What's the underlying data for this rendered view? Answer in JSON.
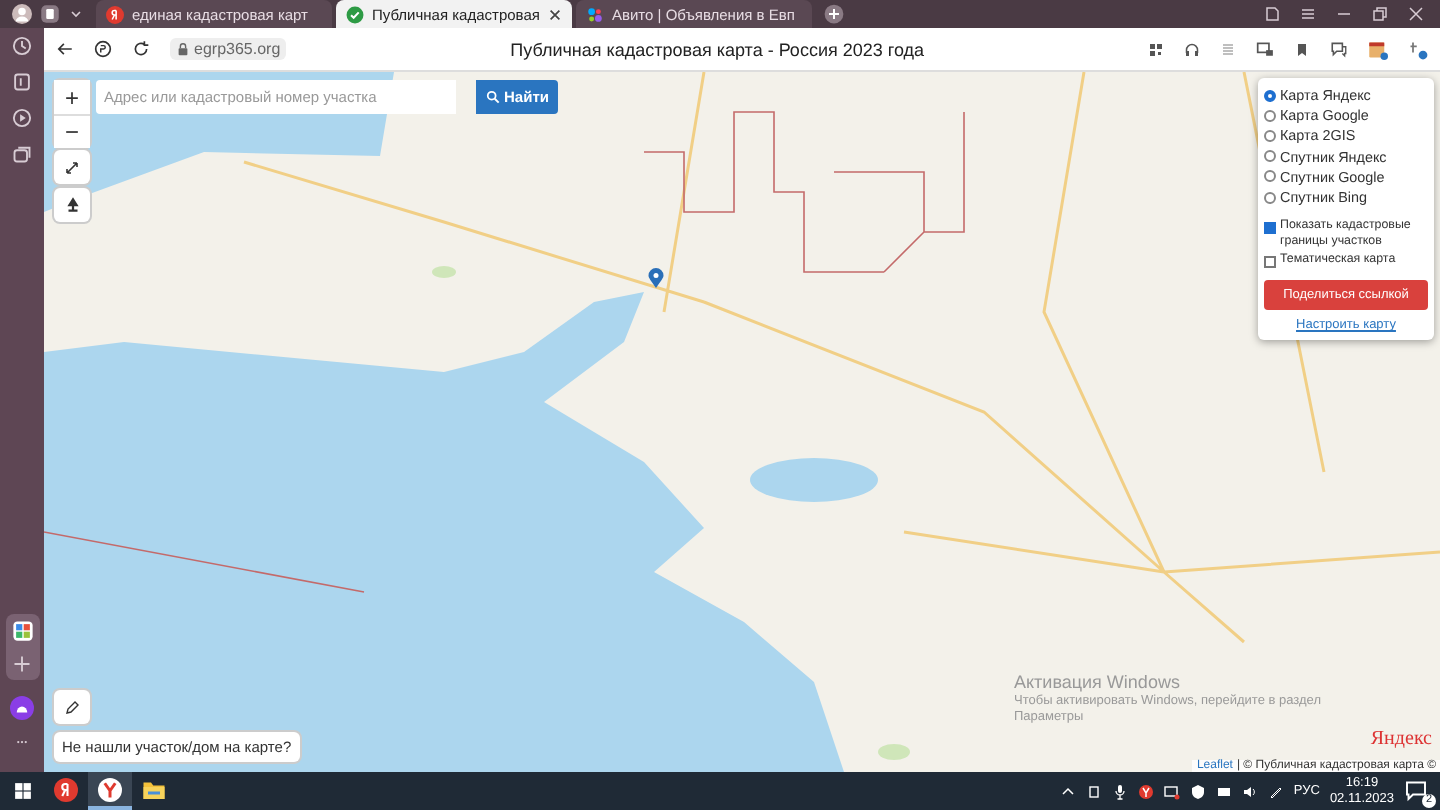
{
  "browser": {
    "tabs": [
      {
        "title": "единая кадастровая карт",
        "kind": "yandex",
        "selected": false
      },
      {
        "title": "Публичная кадастровая",
        "kind": "shield",
        "selected": true
      },
      {
        "title": "Авито | Объявления в Евп",
        "kind": "avito",
        "selected": false
      }
    ],
    "domain": "egrp365.org",
    "page_title": "Публичная кадастровая карта - Россия 2023 года"
  },
  "map": {
    "zoom_in": "+",
    "zoom_out": "−",
    "search": {
      "placeholder": "Адрес или кадастровый номер участка",
      "button": "Найти"
    },
    "layers": [
      {
        "label": "Карта Яндекс",
        "selected": true
      },
      {
        "label": "Карта Google",
        "selected": false
      },
      {
        "label": "Карта 2GIS",
        "selected": false
      },
      {
        "label": "Спутник Яндекс",
        "selected": false
      },
      {
        "label": "Спутник Google",
        "selected": false
      },
      {
        "label": "Спутник Bing",
        "selected": false
      }
    ],
    "options": [
      {
        "label": "Показать кадастровые границы участков",
        "checked": true
      },
      {
        "label": "Тематическая карта",
        "checked": false
      }
    ],
    "share_button": "Поделиться ссылкой",
    "settings_link": "Настроить карту",
    "help_tip": "Не нашли участок/дом на карте?",
    "provider_logo": "Яндекс",
    "attribution_link": "Leaflet",
    "attribution_text": "| © Публичная кадастровая карта ©"
  },
  "os_notice": {
    "title": "Активация Windows",
    "text": "Чтобы активировать Windows, перейдите в раздел",
    "link": "Параметры"
  },
  "taskbar": {
    "apps": [
      {
        "kind": "yandex",
        "selected": false
      },
      {
        "kind": "browser",
        "selected": true
      },
      {
        "kind": "folder",
        "selected": false
      }
    ],
    "language": "РУС",
    "time": "16:19",
    "date": "02.11.2023",
    "notifications": "2"
  }
}
